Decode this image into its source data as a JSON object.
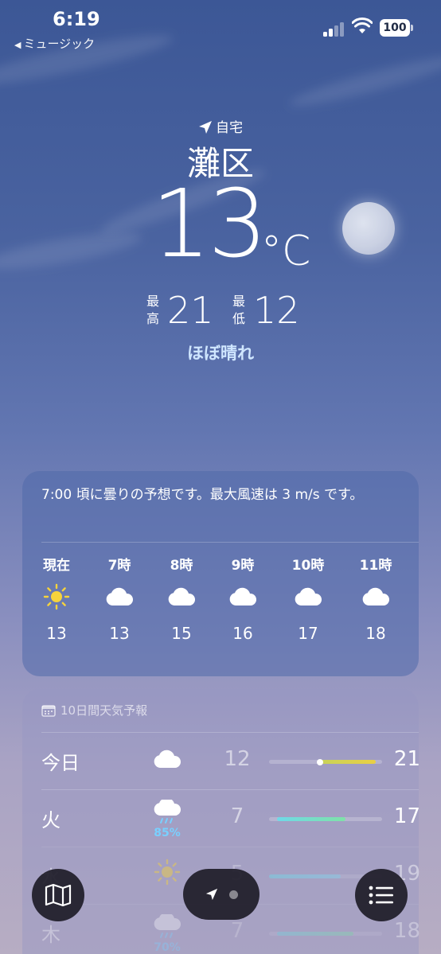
{
  "status_bar": {
    "time": "6:19",
    "back_label": "ミュージック",
    "battery": "100"
  },
  "header": {
    "location_label": "自宅",
    "city": "灘区",
    "temperature": "13",
    "unit": "°C",
    "high_label": "最高",
    "high": "21",
    "low_label": "最低",
    "low": "12",
    "condition": "ほぼ晴れ"
  },
  "hourly": {
    "summary": "7:00 頃に曇りの予想です。最大風速は 3 m/s です。",
    "items": [
      {
        "label": "現在",
        "icon": "sun-icon",
        "temp": "13"
      },
      {
        "label": "7時",
        "icon": "cloud-icon",
        "temp": "13"
      },
      {
        "label": "8時",
        "icon": "cloud-icon",
        "temp": "15"
      },
      {
        "label": "9時",
        "icon": "cloud-icon",
        "temp": "16"
      },
      {
        "label": "10時",
        "icon": "cloud-icon",
        "temp": "17"
      },
      {
        "label": "11時",
        "icon": "cloud-icon",
        "temp": "18"
      }
    ]
  },
  "daily": {
    "title": "10日間天気予報",
    "rows": [
      {
        "day": "今日",
        "icon": "cloud-icon",
        "pop": "",
        "low": "12",
        "high": "21"
      },
      {
        "day": "火",
        "icon": "rain-icon",
        "pop": "85%",
        "low": "7",
        "high": "17"
      },
      {
        "day": "水",
        "icon": "sun-icon",
        "pop": "",
        "low": "5",
        "high": "19"
      },
      {
        "day": "木",
        "icon": "rain-icon",
        "pop": "70%",
        "low": "7",
        "high": "18"
      }
    ]
  },
  "toolbar": {
    "map_icon": "map-icon",
    "location_icon": "location-arrow-icon",
    "list_icon": "list-icon"
  },
  "colors": {
    "condition_text": "#cfe6ff",
    "precip": "#79d0ff",
    "bar_warm": "#e3d24a",
    "bar_cool": "#6fe0cf"
  }
}
